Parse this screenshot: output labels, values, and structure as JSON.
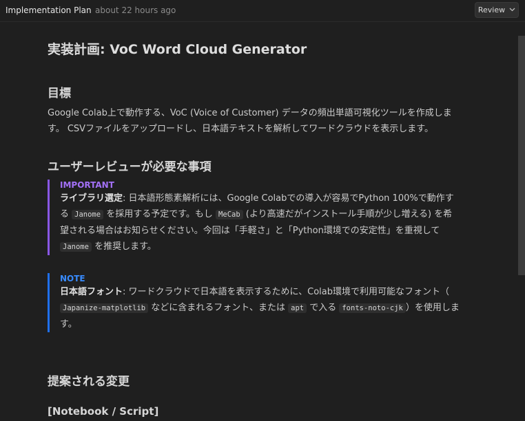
{
  "header": {
    "title": "Implementation Plan",
    "timestamp": "about 22 hours ago",
    "review_label": "Review",
    "review_icon": "chevron-down-icon"
  },
  "doc": {
    "title": "実装計画: VoC Word Cloud Generator",
    "goal_heading": "目標",
    "goal_text": "Google Colab上で動作する、VoC (Voice of Customer) データの頻出単語可視化ツールを作成します。 CSVファイルをアップロードし、日本語テキストを解析してワードクラウドを表示します。",
    "review_heading": "ユーザーレビューが必要な事項",
    "important": {
      "label": "IMPORTANT",
      "bold": "ライブラリ選定",
      "t1": ": 日本語形態素解析には、Google Colabでの導入が容易でPython 100%で動作する ",
      "code1": "Janome",
      "t2": " を採用する予定です。もし ",
      "code2": "MeCab",
      "t3": " (より高速だがインストール手順が少し増える) を希望される場合はお知らせください。今回は「手軽さ」と「Python環境での安定性」を重視して ",
      "code3": "Janome",
      "t4": " を推奨します。"
    },
    "note": {
      "label": "NOTE",
      "bold": "日本語フォント",
      "t1": ": ワードクラウドで日本語を表示するために、Colab環境で利用可能なフォント（ ",
      "code1": "Japanize-matplotlib",
      "t2": " などに含まれるフォント、または ",
      "code2": "apt",
      "t3": " で入る ",
      "code3": "fonts-noto-cjk",
      "t4": "）を使用します。"
    },
    "changes_heading": "提案される変更",
    "changes_subheading": "[Notebook / Script]"
  },
  "colors": {
    "background": "#1f1f1f",
    "important_accent": "#8957e5",
    "note_accent": "#1f6feb"
  }
}
